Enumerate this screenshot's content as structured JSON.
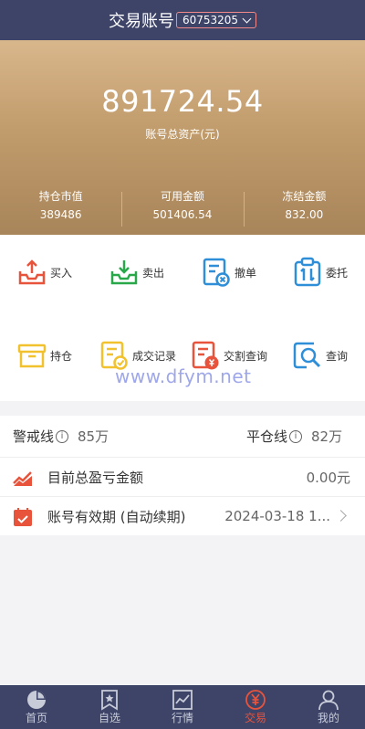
{
  "header": {
    "title": "交易账号",
    "account_number": "60753205"
  },
  "summary": {
    "total_assets": "891724.54",
    "total_assets_label": "账号总资产(元)",
    "stats": [
      {
        "label": "持仓市值",
        "value": "389486"
      },
      {
        "label": "可用金额",
        "value": "501406.54"
      },
      {
        "label": "冻结金额",
        "value": "832.00"
      }
    ]
  },
  "actions": [
    {
      "label": "买入",
      "icon": "buy-tray-icon",
      "color": "#e8533c"
    },
    {
      "label": "卖出",
      "icon": "sell-tray-icon",
      "color": "#29a84a"
    },
    {
      "label": "撤单",
      "icon": "cancel-order-icon",
      "color": "#2e8fd8"
    },
    {
      "label": "委托",
      "icon": "entrust-icon",
      "color": "#2e8fd8"
    },
    {
      "label": "持仓",
      "icon": "holdings-box-icon",
      "color": "#f2c12e"
    },
    {
      "label": "成交记录",
      "icon": "trade-record-icon",
      "color": "#f2c12e"
    },
    {
      "label": "交割查询",
      "icon": "settlement-query-icon",
      "color": "#e8533c"
    },
    {
      "label": "查询",
      "icon": "search-query-icon",
      "color": "#2e8fd8"
    }
  ],
  "watermark": "www.dfym.net",
  "risk": {
    "warning_label": "警戒线",
    "warning_value": "85万",
    "liquidation_label": "平仓线",
    "liquidation_value": "82万",
    "info_glyph": "i"
  },
  "rows": [
    {
      "label": "目前总盈亏金额",
      "value": "0.00元",
      "icon": "trend-chart-icon"
    },
    {
      "label": "账号有效期 (自动续期)",
      "value": "2024-03-18 1...",
      "icon": "calendar-icon"
    }
  ],
  "tabbar": [
    {
      "label": "首页",
      "icon": "pie-chart-icon",
      "active": false
    },
    {
      "label": "自选",
      "icon": "bookmark-star-icon",
      "active": false
    },
    {
      "label": "行情",
      "icon": "line-chart-icon",
      "active": false
    },
    {
      "label": "交易",
      "icon": "yen-circle-icon",
      "active": true
    },
    {
      "label": "我的",
      "icon": "user-icon",
      "active": false
    }
  ],
  "colors": {
    "header_bg": "#3d4468",
    "hero_top": "#d9b78c",
    "hero_bottom": "#a8855a",
    "accent": "#e8533c"
  }
}
